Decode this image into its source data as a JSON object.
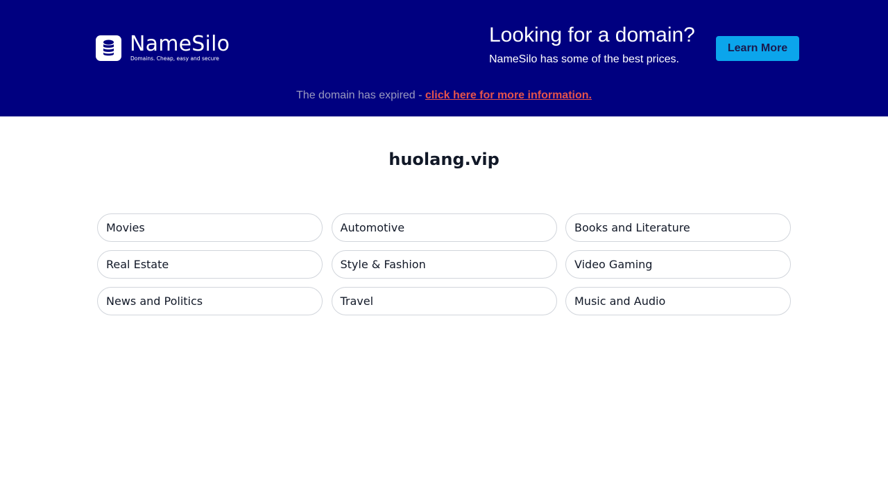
{
  "brand": {
    "name": "NameSilo",
    "tagline": "Domains. Cheap, easy and secure",
    "logo_icon": "database-icon",
    "banner_color": "#000080"
  },
  "promo": {
    "title": "Looking for a domain?",
    "subtitle": "NameSilo has some of the best prices.",
    "button_label": "Learn More",
    "button_color": "#0ba5ec"
  },
  "notice": {
    "text": "The domain has expired - ",
    "link_text": "click here for more information.",
    "link_color": "#e5534b"
  },
  "domain": {
    "name": "huolang.vip"
  },
  "categories": [
    "Movies",
    "Automotive",
    "Books and Literature",
    "Real Estate",
    "Style & Fashion",
    "Video Gaming",
    "News and Politics",
    "Travel",
    "Music and Audio"
  ]
}
